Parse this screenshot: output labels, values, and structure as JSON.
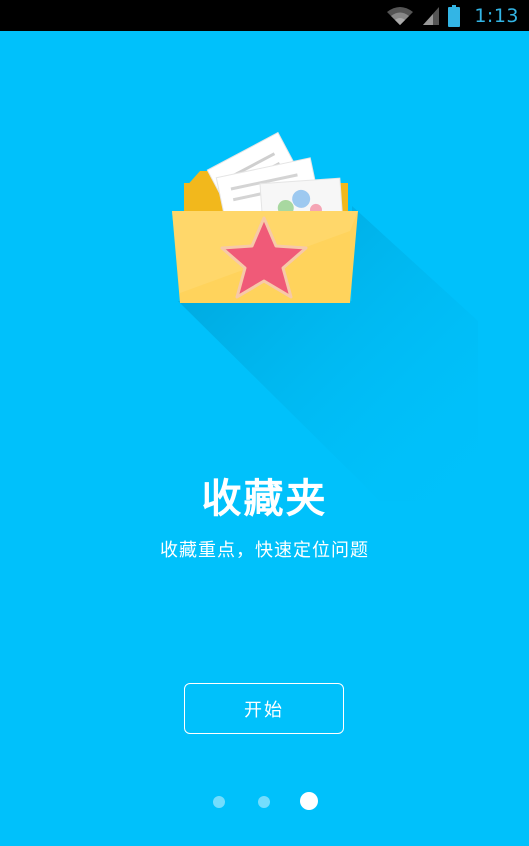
{
  "status_bar": {
    "time": "1:13",
    "icons": [
      "wifi-icon",
      "signal-icon",
      "battery-icon"
    ]
  },
  "illustration": {
    "icon": "favorites-folder-icon",
    "star_icon": "star-icon"
  },
  "main": {
    "title": "收藏夹",
    "subtitle": "收藏重点，快速定位问题",
    "start_label": "开始"
  },
  "pager": {
    "count": 3,
    "active_index": 2
  },
  "colors": {
    "background": "#00C1FB",
    "folder": "#FFD35C",
    "folder_back": "#F2B81C",
    "star": "#F05A78",
    "status_bar": "#000000",
    "clock": "#33B5E5"
  }
}
